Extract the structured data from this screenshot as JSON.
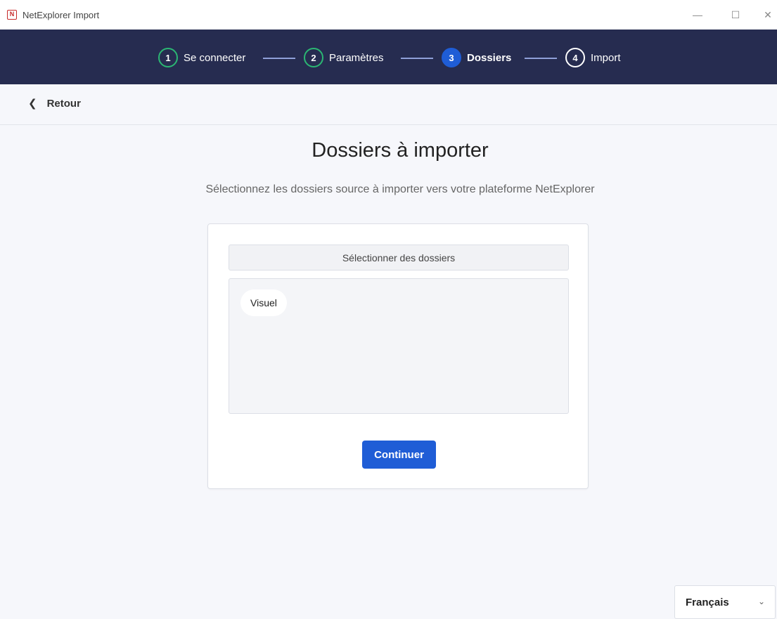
{
  "window": {
    "title": "NetExplorer Import",
    "logo_letter": "N",
    "controls": {
      "minimize": "—",
      "maximize": "☐",
      "close": "✕"
    }
  },
  "stepper": {
    "steps": [
      {
        "number": "1",
        "label": "Se connecter",
        "state": "done"
      },
      {
        "number": "2",
        "label": "Paramètres",
        "state": "done"
      },
      {
        "number": "3",
        "label": "Dossiers",
        "state": "active"
      },
      {
        "number": "4",
        "label": "Import",
        "state": "todo"
      }
    ],
    "colors": {
      "bar": "#262c50",
      "done": "#2bb673",
      "active": "#1f5dd6"
    }
  },
  "back": {
    "label": "Retour",
    "icon": "chevron-left-icon"
  },
  "main": {
    "title": "Dossiers à importer",
    "subtitle": "Sélectionnez les dossiers source à importer vers votre plateforme NetExplorer",
    "select_button_label": "Sélectionner des dossiers",
    "selected_folders": [
      "Visuel"
    ],
    "continue_label": "Continuer"
  },
  "language": {
    "selected": "Français",
    "icon": "chevron-down-icon"
  }
}
